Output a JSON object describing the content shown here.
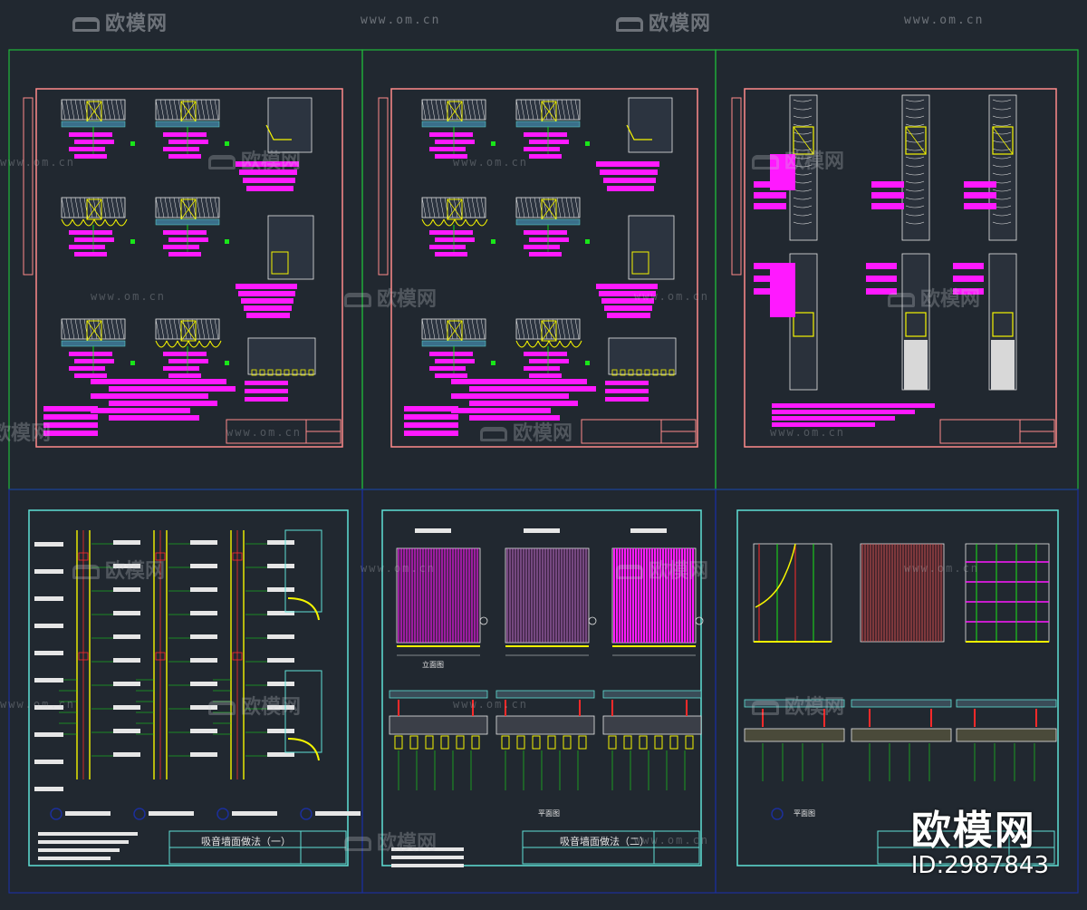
{
  "watermark": {
    "brand_text": "欧模网",
    "url_text": "www.om.cn",
    "big_logo": "欧模网",
    "id_text": "ID:2987843"
  },
  "sheets": {
    "bottom_left_title": "吸音墙面做法（一）",
    "bottom_middle_title": "吸音墙面做法（二）",
    "bottom_right_plan_label": "平面图",
    "bottom_middle_elevation_label": "立面图",
    "bottom_middle_plan_label": "平面图"
  },
  "colors": {
    "background": "#212830",
    "green_frame": "#1fb83a",
    "blue_frame": "#1c2f9a",
    "red_border": "#ff8a8a",
    "cyan_border": "#5fe0d6",
    "magenta": "#ff19ff",
    "yellow": "#f5f500",
    "white_line": "#e6e6e6",
    "green_line": "#19e619",
    "red_line": "#ff2a2a"
  }
}
